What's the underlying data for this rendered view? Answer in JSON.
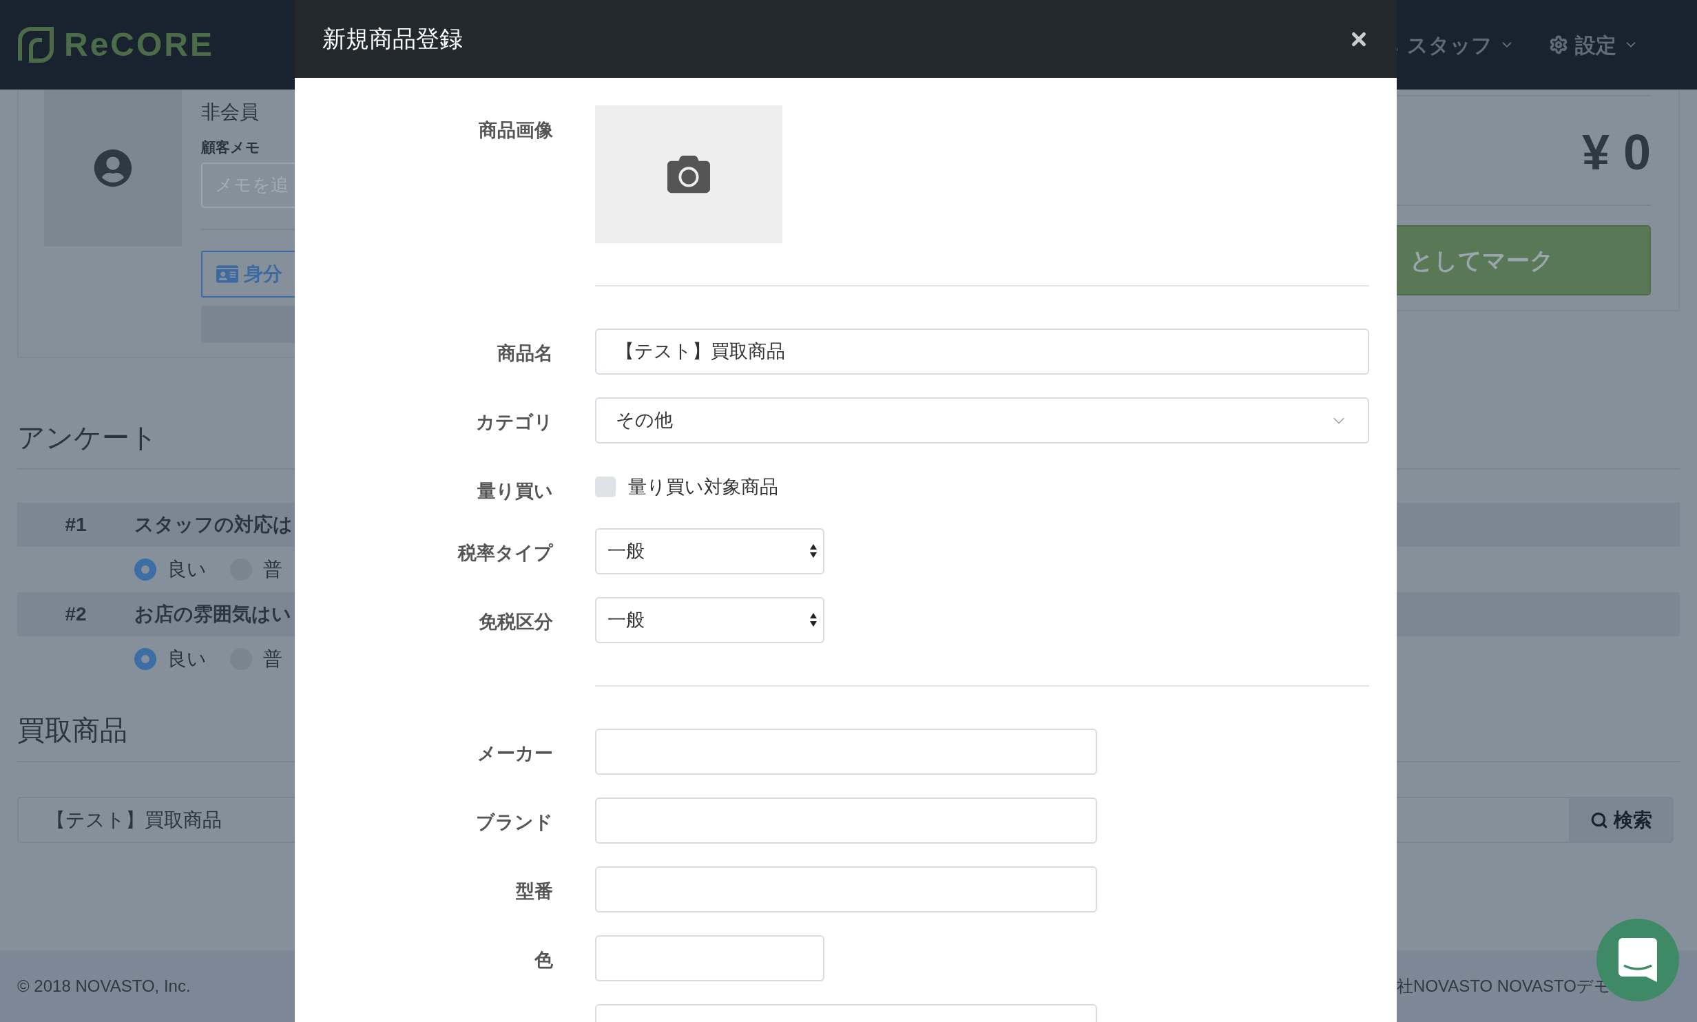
{
  "app_header": {
    "logo": "ReCORE",
    "menus": [
      {
        "label": "スタッフ"
      },
      {
        "label": "設定"
      }
    ]
  },
  "customer": {
    "status": "非会員",
    "memo_label": "顧客メモ",
    "memo_placeholder": "メモを追",
    "id_button": "身分"
  },
  "total": {
    "amount": "¥ 0",
    "button": "としてマーク"
  },
  "survey": {
    "title": "アンケート",
    "questions": [
      {
        "number": "#1",
        "text": "スタッフの対応は",
        "options": [
          {
            "label": "良い",
            "selected": true
          },
          {
            "label": "普",
            "selected": false
          }
        ]
      },
      {
        "number": "#2",
        "text": "お店の雰囲気はい",
        "options": [
          {
            "label": "良い",
            "selected": true
          },
          {
            "label": "普",
            "selected": false
          }
        ]
      }
    ]
  },
  "purchase": {
    "title": "買取商品",
    "search_value": "【テスト】買取商品",
    "search_button": "検索"
  },
  "footer": {
    "copyright": "© 2018 NOVASTO, Inc.",
    "shop": "社NOVASTO NOVASTOデモ"
  },
  "modal": {
    "title": "新規商品登録",
    "fields": [
      {
        "kind": "image",
        "label": "商品画像"
      },
      {
        "kind": "divider"
      },
      {
        "kind": "wide",
        "label": "商品名",
        "value": "【テスト】買取商品"
      },
      {
        "kind": "select",
        "label": "カテゴリ",
        "value": "その他"
      },
      {
        "kind": "checkbox",
        "label": "量り買い",
        "text": "量り買い対象商品",
        "checked": false
      },
      {
        "kind": "spinner",
        "label": "税率タイプ",
        "value": "一般"
      },
      {
        "kind": "spinner",
        "label": "免税区分",
        "value": "一般"
      },
      {
        "kind": "divider"
      },
      {
        "kind": "text",
        "label": "メーカー"
      },
      {
        "kind": "text",
        "label": "ブランド"
      },
      {
        "kind": "text",
        "label": "型番"
      },
      {
        "kind": "short",
        "label": "色"
      },
      {
        "kind": "text"
      }
    ]
  }
}
